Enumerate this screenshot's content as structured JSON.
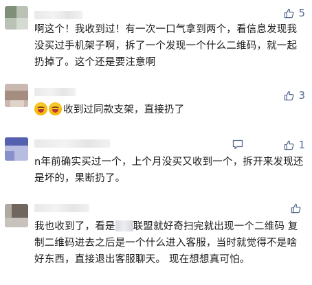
{
  "colors": {
    "accent": "#57698f",
    "text": "#1a1a1a",
    "background": "#ffffff"
  },
  "comments": [
    {
      "likes": "5",
      "text": "啊这个！我收到过！有一次一口气拿到两个，看信息发现我没买过手机架子啊，拆了一个发现一个什么二维码，就一起扔掉了。这个还是要注意啊"
    },
    {
      "likes": "3",
      "emoji": [
        "grinning-sweat-emoji",
        "grinning-sweat-emoji"
      ],
      "text": "收到过同款支架，直接扔了"
    },
    {
      "likes": "1",
      "text": "n年前确实买过一个，上个月没买又收到一个，拆开来发现还是坏的，果断扔了。"
    },
    {
      "likes": "",
      "text_before": "我也收到了，看是",
      "text_after": "联盟就好奇扫完就出现一个二维码 复制二维码进去之后是一个什么进入客服，当时就觉得不是啥好东西，直接退出客服聊天。 现在想想真可怕。"
    }
  ]
}
